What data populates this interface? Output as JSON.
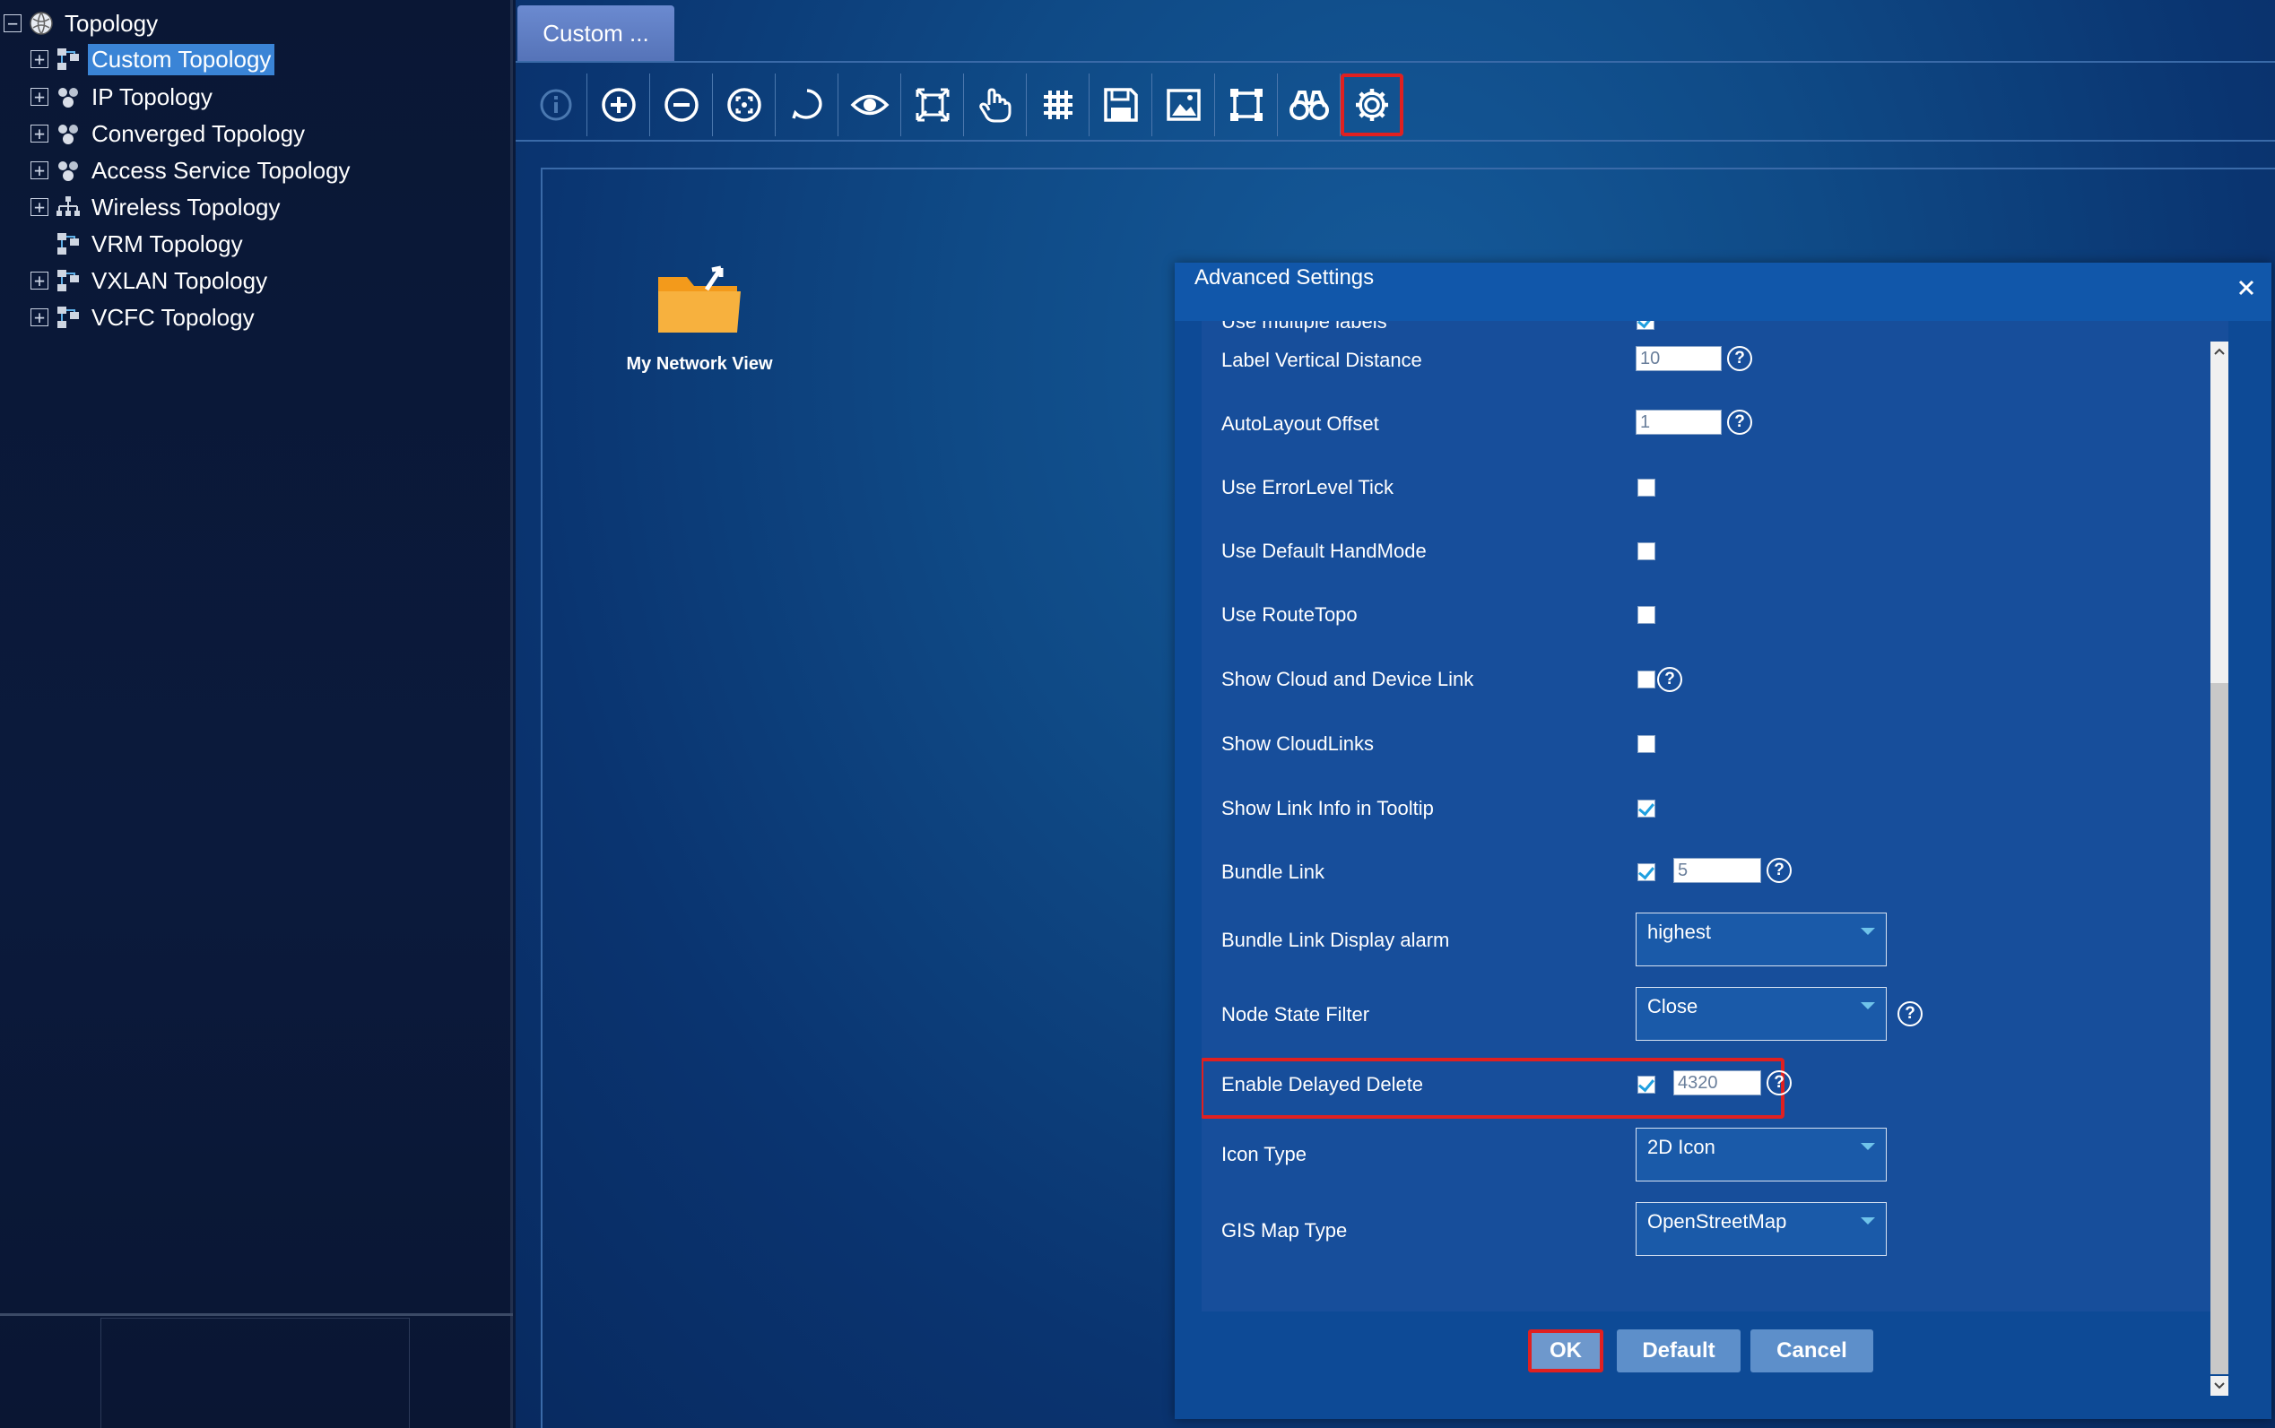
{
  "tree": {
    "root": "Topology",
    "items": [
      {
        "label": "Custom Topology",
        "selected": true,
        "expandable": true
      },
      {
        "label": "IP Topology",
        "expandable": true
      },
      {
        "label": "Converged Topology",
        "expandable": true
      },
      {
        "label": "Access Service Topology",
        "expandable": true
      },
      {
        "label": "Wireless Topology",
        "expandable": true
      },
      {
        "label": "VRM Topology",
        "expandable": false
      },
      {
        "label": "VXLAN Topology",
        "expandable": true
      },
      {
        "label": "VCFC Topology",
        "expandable": true
      }
    ]
  },
  "main": {
    "tab_label": "Custom ...",
    "toolbar_icons": [
      "info-icon",
      "zoom-in-icon",
      "zoom-out-icon",
      "fit-view-icon",
      "lasso-icon",
      "eye-icon",
      "fullscreen-icon",
      "hand-icon",
      "grid-icon",
      "save-icon",
      "image-icon",
      "frame-icon",
      "binoculars-icon",
      "gear-icon"
    ],
    "canvas": {
      "node_label": "My Network View"
    }
  },
  "dialog": {
    "title": "Advanced Settings",
    "rows": {
      "multiple_labels": {
        "label": "Use multiple labels",
        "checked": true
      },
      "label_vertical_distance": {
        "label": "Label Vertical Distance",
        "value": "10"
      },
      "autolayout_offset": {
        "label": "AutoLayout Offset",
        "value": "1"
      },
      "errorlevel_tick": {
        "label": "Use ErrorLevel Tick",
        "checked": false
      },
      "default_handmode": {
        "label": "Use Default HandMode",
        "checked": false
      },
      "routetopo": {
        "label": "Use RouteTopo",
        "checked": false
      },
      "cloud_device_link": {
        "label": "Show Cloud and Device Link",
        "checked": false
      },
      "cloudlinks": {
        "label": "Show CloudLinks",
        "checked": false
      },
      "link_info_tooltip": {
        "label": "Show Link Info in Tooltip",
        "checked": true
      },
      "bundle_link": {
        "label": "Bundle Link",
        "checked": true,
        "value": "5"
      },
      "bundle_link_alarm": {
        "label": "Bundle Link Display alarm",
        "value": "highest"
      },
      "node_state_filter": {
        "label": "Node State Filter",
        "value": "Close"
      },
      "delayed_delete": {
        "label": "Enable Delayed Delete",
        "checked": true,
        "value": "4320"
      },
      "icon_type": {
        "label": "Icon Type",
        "value": "2D Icon"
      },
      "gis_map_type": {
        "label": "GIS Map Type",
        "value": "OpenStreetMap"
      }
    },
    "help_glyph": "?",
    "buttons": {
      "ok": "OK",
      "default": "Default",
      "cancel": "Cancel"
    }
  },
  "colors": {
    "highlight": "#e02020",
    "selection": "#3a84d6",
    "dialog_bg": "#0d4a96"
  }
}
